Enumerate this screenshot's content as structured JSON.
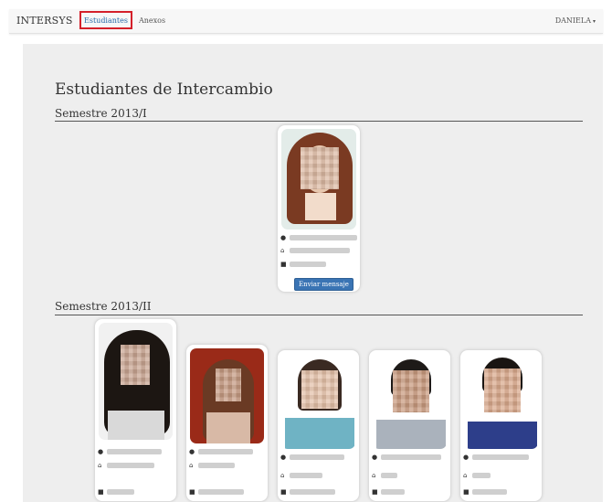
{
  "navbar": {
    "brand": "INTERSYS",
    "links": [
      "Estudiantes",
      "Anexos"
    ],
    "user": "DANIELA"
  },
  "page": {
    "title": "Estudiantes de Intercambio",
    "sections": [
      {
        "title": "Semestre 2013/I",
        "button": "Enviar mensaje"
      },
      {
        "title": "Semestre 2013/II"
      }
    ]
  },
  "icons": {
    "user": "user-icon",
    "home": "home-icon",
    "book": "book-icon"
  },
  "colors": {
    "accent": "#3a74b4",
    "highlight": "#d4202a",
    "panel": "#eeeeee"
  }
}
